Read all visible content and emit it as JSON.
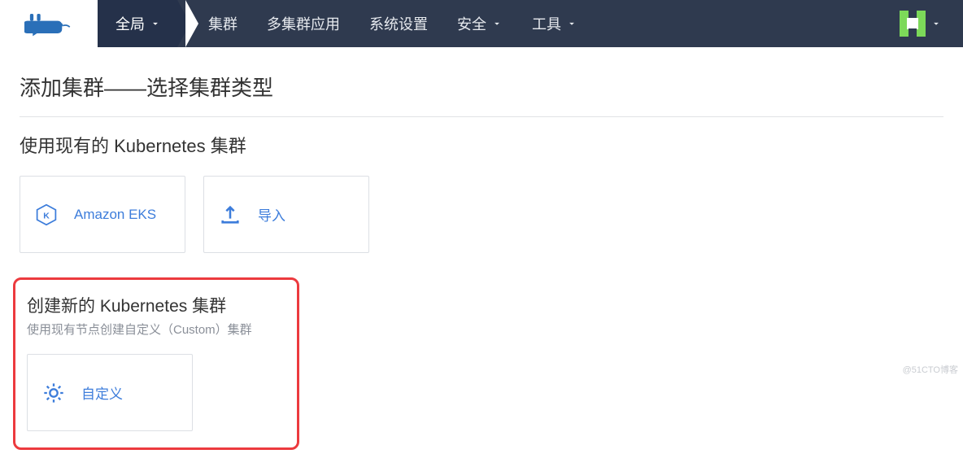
{
  "nav": {
    "global": "全局",
    "items": [
      "集群",
      "多集群应用",
      "系统设置",
      "安全",
      "工具"
    ],
    "dropdown_indices": [
      3,
      4
    ]
  },
  "page": {
    "title": "添加集群——选择集群类型"
  },
  "existing_section": {
    "title": "使用现有的 Kubernetes 集群",
    "cards": [
      {
        "label": "Amazon EKS",
        "icon": "eks"
      },
      {
        "label": "导入",
        "icon": "import"
      }
    ]
  },
  "create_section": {
    "title": "创建新的 Kubernetes 集群",
    "subtitle": "使用现有节点创建自定义（Custom）集群",
    "cards": [
      {
        "label": "自定义",
        "icon": "custom"
      }
    ]
  },
  "watermark": "@51CTO博客"
}
